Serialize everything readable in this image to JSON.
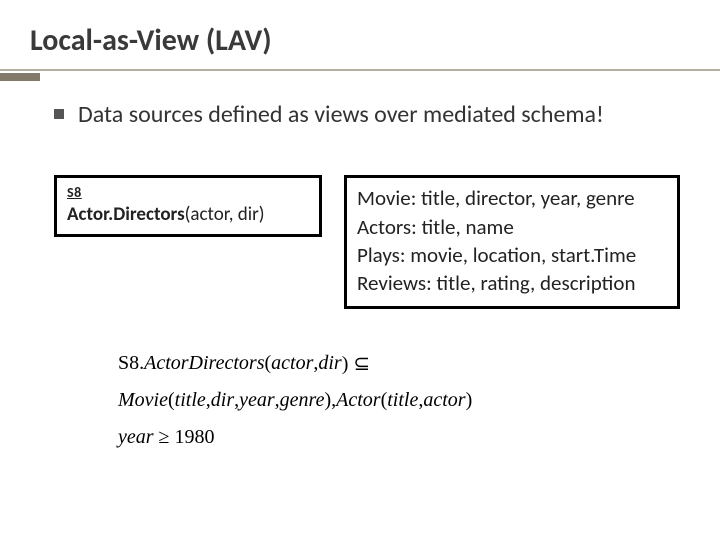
{
  "title": "Local-as-View (LAV)",
  "bullet": "Data sources defined as views over mediated schema!",
  "source": {
    "label": "S8",
    "rel_bold": "Actor.Directors",
    "rel_args": "(actor, dir)"
  },
  "schema": {
    "l1": "Movie: title, director, year, genre",
    "l2": "Actors: title, name",
    "l3": "Plays: movie, location, start.Time",
    "l4": "Reviews: title, rating, description"
  },
  "formula": {
    "r1_a": "S8.",
    "r1_b": "ActorDirectors",
    "r1_c": "(",
    "r1_d": "actor",
    "r1_e": ",",
    "r1_f": "dir",
    "r1_g": ") ⊆",
    "r2_a": "Movie",
    "r2_b": "(",
    "r2_c": "title",
    "r2_d": ",",
    "r2_e": "dir",
    "r2_f": ",",
    "r2_g": "year",
    "r2_h": ",",
    "r2_i": "genre",
    "r2_j": "),",
    "r2_k": "Actor",
    "r2_l": "(",
    "r2_m": "title",
    "r2_n": ",",
    "r2_o": "actor",
    "r2_p": ")",
    "r3_a": "year",
    "r3_b": " ≥ 1980"
  }
}
